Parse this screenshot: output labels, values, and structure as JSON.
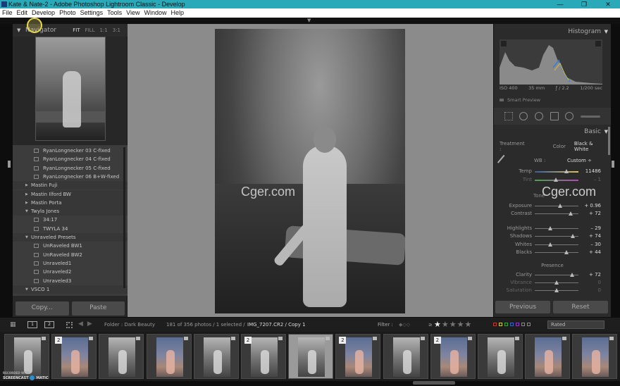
{
  "window": {
    "title": "Kate & Nate-2 - Adobe Photoshop Lightroom Classic - Develop",
    "min": "—",
    "max": "❐",
    "close": "✕"
  },
  "menu": [
    "File",
    "Edit",
    "Develop",
    "Photo",
    "Settings",
    "Tools",
    "View",
    "Window",
    "Help"
  ],
  "navigator": {
    "title": "Navigator",
    "fit": "FIT",
    "fill": "FILL",
    "z1": "1:1",
    "z3": "3:1"
  },
  "presets": [
    {
      "type": "item",
      "label": "RyanLongnecker 03 C-fixed"
    },
    {
      "type": "item",
      "label": "RyanLongnecker 04 C-fixed"
    },
    {
      "type": "item",
      "label": "RyanLongnecker 05 C-fixed"
    },
    {
      "type": "item",
      "label": "RyanLongnecker 06 B+W-fixed"
    },
    {
      "type": "folder",
      "open": false,
      "label": "Mastin Fuji"
    },
    {
      "type": "folder",
      "open": false,
      "label": "Mastin Ilford BW"
    },
    {
      "type": "folder",
      "open": false,
      "label": "Mastin Porta"
    },
    {
      "type": "folder",
      "open": true,
      "label": "Twyla Jones"
    },
    {
      "type": "item",
      "label": "34:17"
    },
    {
      "type": "item",
      "label": "TWYLA 34"
    },
    {
      "type": "folder",
      "open": true,
      "label": "Unraveled Presets"
    },
    {
      "type": "item",
      "label": "UnRaveled BW1"
    },
    {
      "type": "item",
      "label": "UnRaveled BW2"
    },
    {
      "type": "item",
      "label": "Unraveled1"
    },
    {
      "type": "item",
      "label": "Unraveled2"
    },
    {
      "type": "item",
      "label": "Unraveled3"
    },
    {
      "type": "folder",
      "open": true,
      "label": "VSCO 1"
    }
  ],
  "left_buttons": {
    "copy": "Copy...",
    "paste": "Paste"
  },
  "watermark": "Cger.com",
  "histogram": {
    "title": "Histogram",
    "iso": "ISO 400",
    "focal": "35 mm",
    "aperture": "ƒ / 2.2",
    "shutter": "1/200 sec",
    "smart_preview": "Smart Preview"
  },
  "basic": {
    "title": "Basic",
    "treatment_label": "Treatment :",
    "color": "Color",
    "bw": "Black & White",
    "wb_label": "WB :",
    "wb_value": "Custom ÷",
    "tone_label": "Tone",
    "presence_label": "Presence",
    "sliders": [
      {
        "label": "Temp",
        "value": "11486",
        "pos": 0.72,
        "kind": "temp"
      },
      {
        "label": "Tint",
        "value": "– 1",
        "pos": 0.49,
        "kind": "tint",
        "dim": true
      },
      {
        "label": "Exposure",
        "value": "+ 0.96",
        "pos": 0.58
      },
      {
        "label": "Contrast",
        "value": "+ 72",
        "pos": 0.83
      },
      {
        "label": "Highlights",
        "value": "– 29",
        "pos": 0.35
      },
      {
        "label": "Shadows",
        "value": "+ 74",
        "pos": 0.87
      },
      {
        "label": "Whites",
        "value": "– 30",
        "pos": 0.35
      },
      {
        "label": "Blacks",
        "value": "+ 44",
        "pos": 0.72
      },
      {
        "label": "Clarity",
        "value": "+ 72",
        "pos": 0.86
      },
      {
        "label": "Vibrance",
        "value": "0",
        "pos": 0.5,
        "dim": true
      },
      {
        "label": "Saturation",
        "value": "0",
        "pos": 0.5,
        "dim": true
      }
    ]
  },
  "right_buttons": {
    "previous": "Previous",
    "reset": "Reset"
  },
  "filmstrip_bar": {
    "screen1": "1",
    "screen2": "2",
    "folder": "Folder : Dark Beauty",
    "count": "181 of 356 photos / 1 selected /",
    "file": "IMG_7207.CR2 / Copy 1",
    "filter_label": "Filter :",
    "rating_op": "≥",
    "stars": 1,
    "rated": "Rated"
  },
  "thumbs": [
    {
      "kind": "bw",
      "badge": ""
    },
    {
      "kind": "col",
      "badge": "2"
    },
    {
      "kind": "bw",
      "badge": ""
    },
    {
      "kind": "col",
      "badge": ""
    },
    {
      "kind": "bw",
      "badge": ""
    },
    {
      "kind": "bw",
      "badge": "2"
    },
    {
      "kind": "bw",
      "badge": "",
      "selected": true
    },
    {
      "kind": "col",
      "badge": "2"
    },
    {
      "kind": "bw",
      "badge": ""
    },
    {
      "kind": "col",
      "badge": "2"
    },
    {
      "kind": "bw",
      "badge": ""
    },
    {
      "kind": "col",
      "badge": ""
    },
    {
      "kind": "col",
      "badge": ""
    }
  ],
  "screencast": {
    "top": "RECORDED WITH",
    "brand": "SCREENCAST",
    "suffix": "MATIC"
  }
}
